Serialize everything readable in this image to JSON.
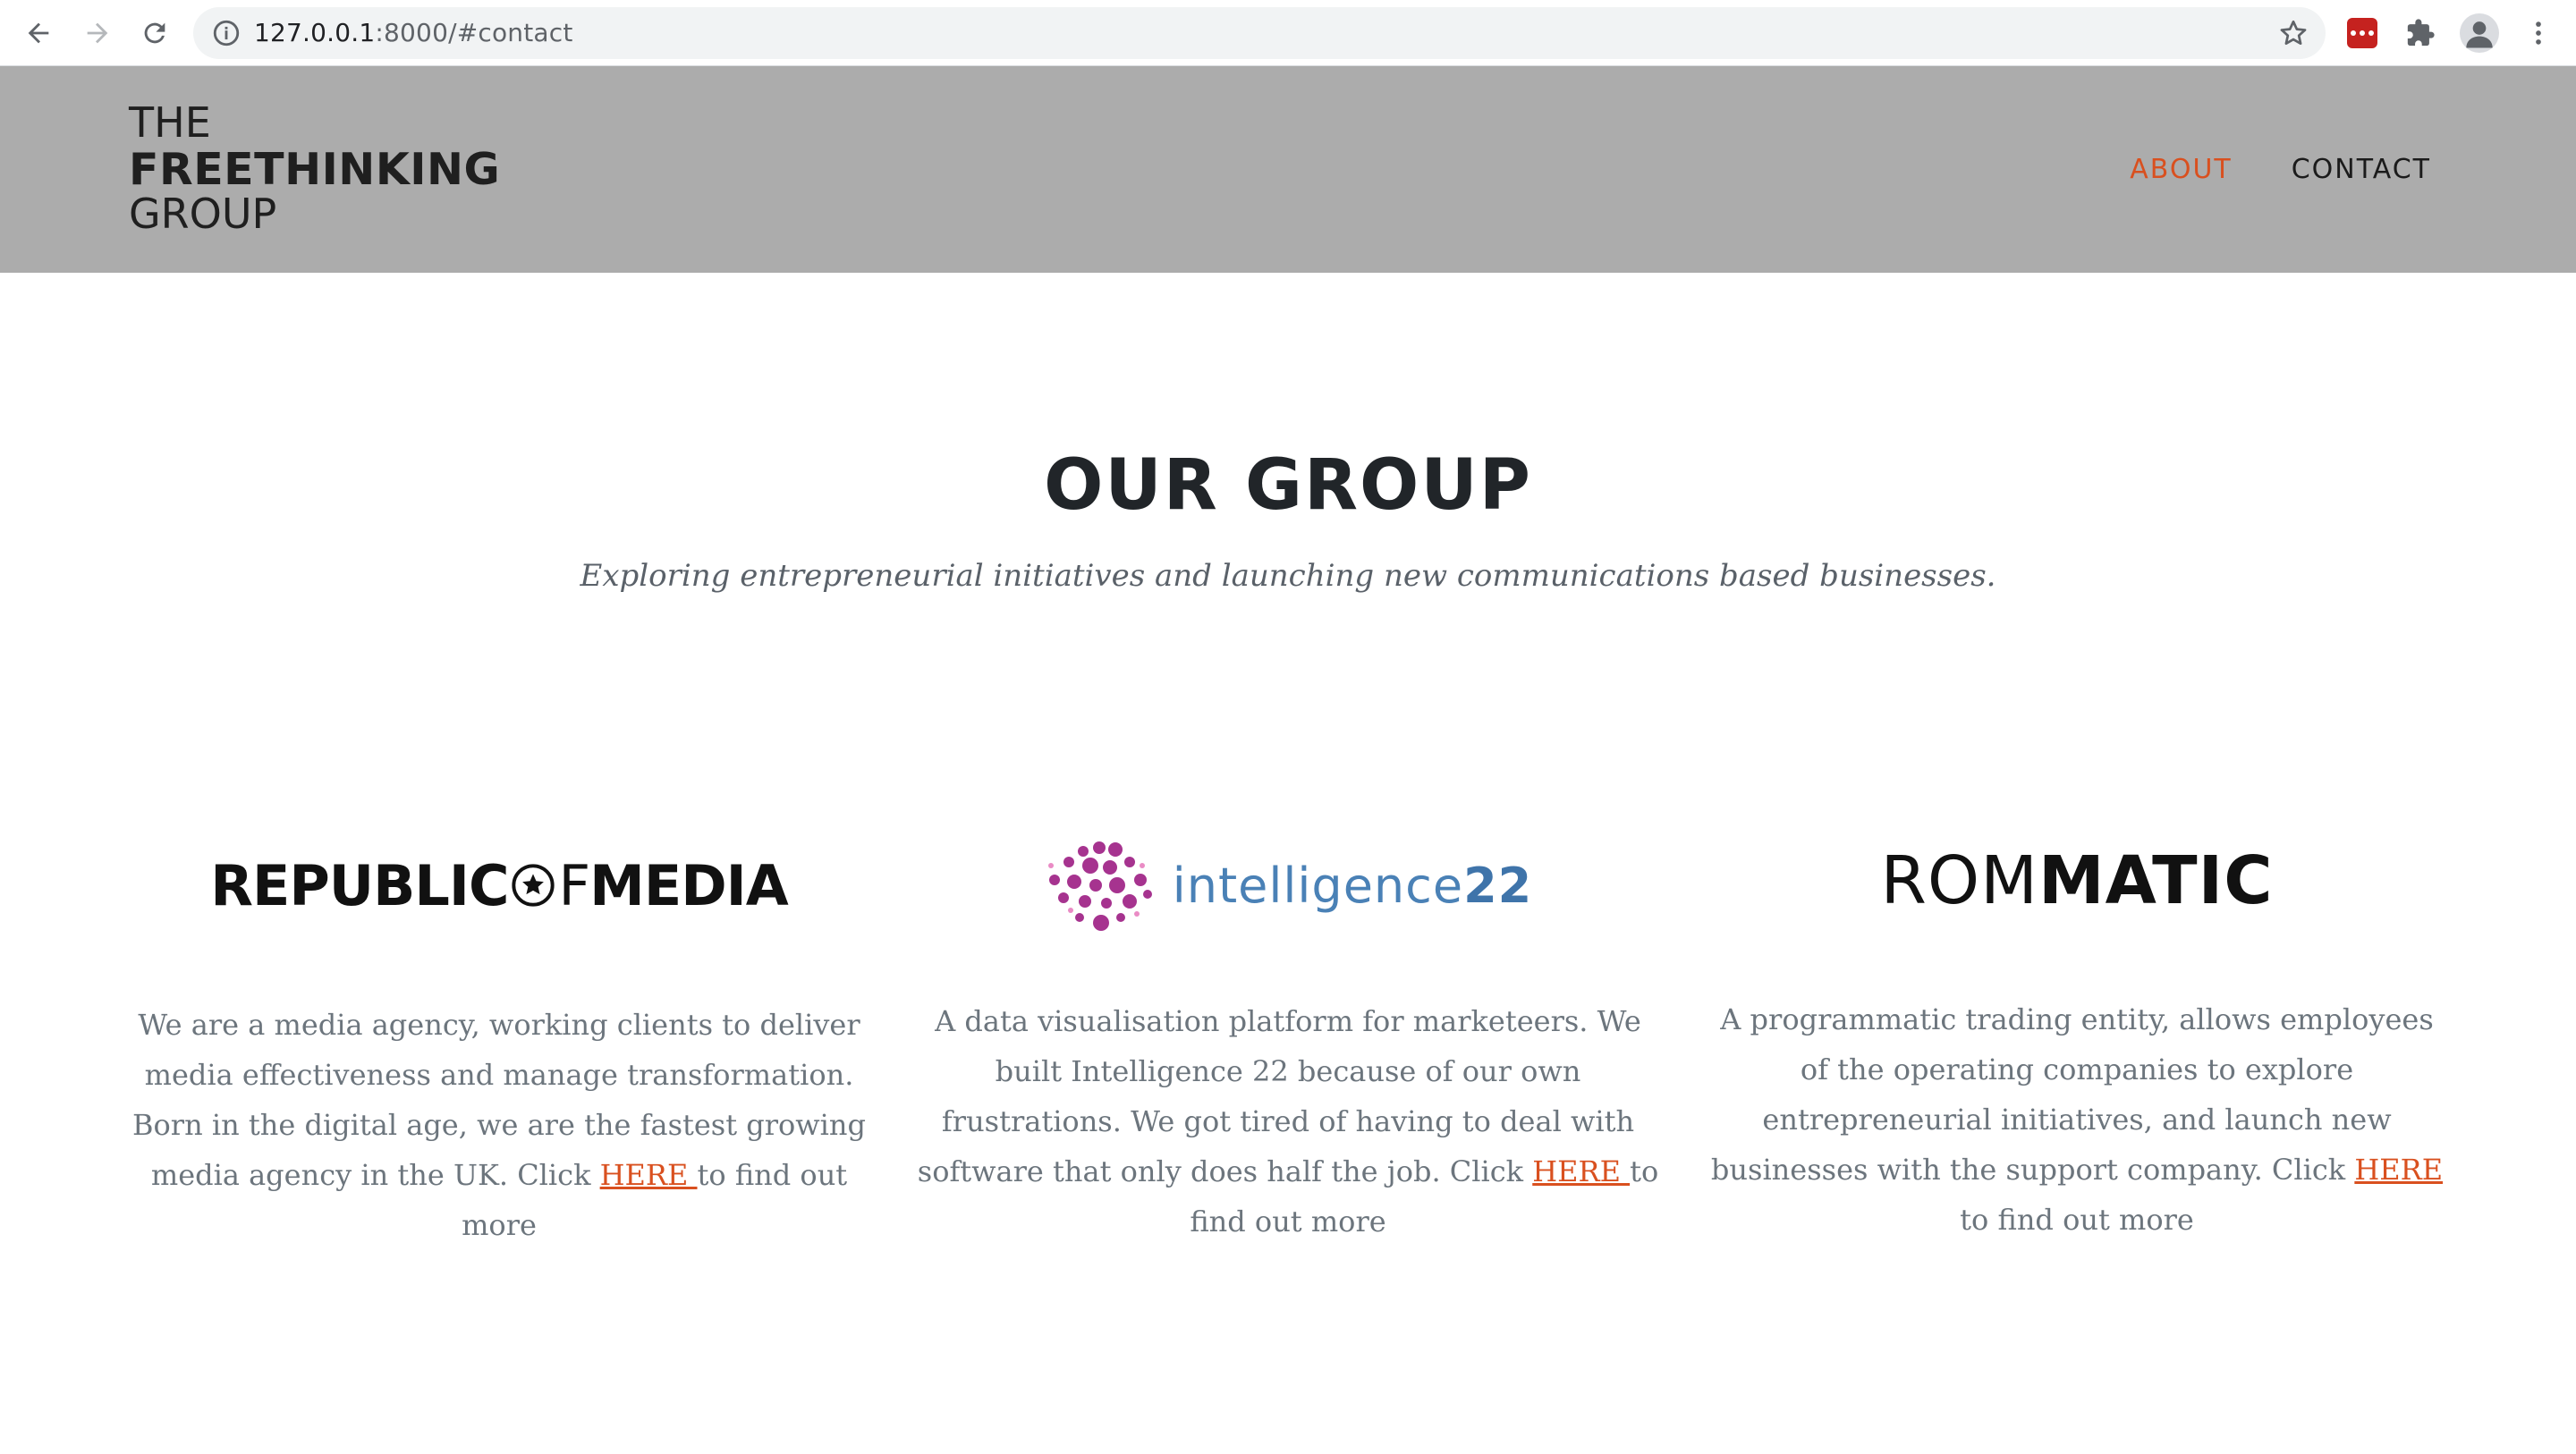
{
  "browser": {
    "url_host": "127.0.0.1",
    "url_rest": ":8000/#contact"
  },
  "site": {
    "logo": {
      "line1": "THE",
      "line2": "FREETHINKING",
      "line3": "GROUP"
    },
    "nav": [
      {
        "label": "ABOUT",
        "active": true
      },
      {
        "label": "CONTACT",
        "active": false
      }
    ],
    "accent_color": "#d9501f",
    "header_bg": "#acacac"
  },
  "section": {
    "title": "OUR GROUP",
    "subtitle": "Exploring entrepreneurial initiatives and launching new communications based businesses."
  },
  "companies": [
    {
      "logo": {
        "part1": "REPUBLIC",
        "of": "F",
        "part2": "MEDIA"
      },
      "text": "We are a media agency, working clients to deliver media effectiveness and manage transformation. Born in the digital age, we are the fastest growing media agency in the UK. Click ",
      "link": "HERE ",
      "suffix": "to find out more"
    },
    {
      "logo": {
        "text": "intelligence",
        "number": "22"
      },
      "text": "A data visualisation platform for marketeers. We built Intelligence 22 because of our own frustrations. We got tired of having to deal with software that only does half the job. Click ",
      "link": "HERE ",
      "suffix": "to find out more"
    },
    {
      "logo": {
        "light": "ROM",
        "bold": "MATIC"
      },
      "text": "A programmatic trading entity, allows employees of the operating companies to explore entrepreneurial initiatives, and launch new businesses with the support company. Click ",
      "link": "HERE ",
      "suffix": "to find out more"
    }
  ]
}
